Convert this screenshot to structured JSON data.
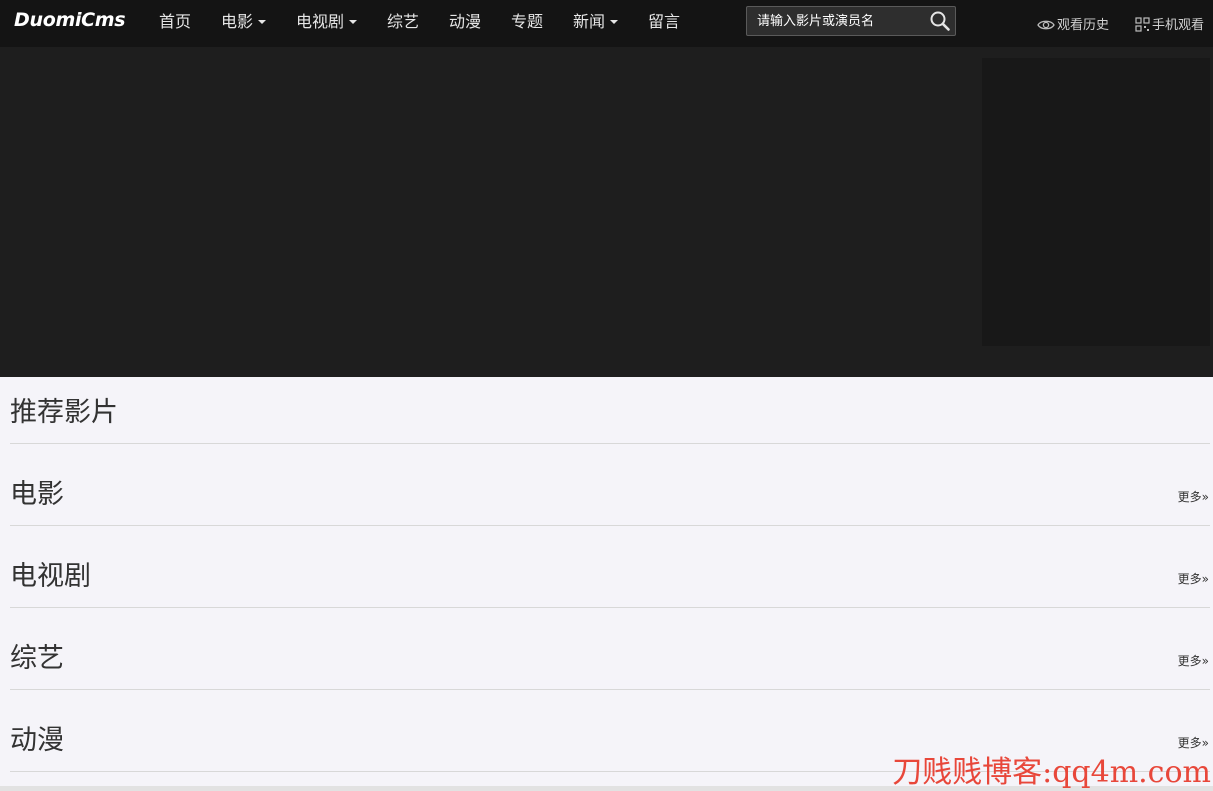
{
  "header": {
    "logo": "DuomiCms",
    "nav": [
      {
        "label": "首页",
        "has_dropdown": false
      },
      {
        "label": "电影",
        "has_dropdown": true
      },
      {
        "label": "电视剧",
        "has_dropdown": true
      },
      {
        "label": "综艺",
        "has_dropdown": false
      },
      {
        "label": "动漫",
        "has_dropdown": false
      },
      {
        "label": "专题",
        "has_dropdown": false
      },
      {
        "label": "新闻",
        "has_dropdown": true
      },
      {
        "label": "留言",
        "has_dropdown": false
      }
    ],
    "search": {
      "placeholder": "请输入影片或演员名",
      "icon": "search-icon"
    },
    "history": {
      "label": "观看历史",
      "icon": "eye-icon"
    },
    "mobile": {
      "label": "手机观看",
      "icon": "qrcode-icon"
    }
  },
  "sections": [
    {
      "title": "推荐影片",
      "more": ""
    },
    {
      "title": "电影",
      "more": "更多»"
    },
    {
      "title": "电视剧",
      "more": "更多»"
    },
    {
      "title": "综艺",
      "more": "更多»"
    },
    {
      "title": "动漫",
      "more": "更多»"
    }
  ],
  "watermark": "刀贱贱博客:qq4m.com",
  "colors": {
    "navbar_bg": "#141414",
    "banner_bg": "#1e1e1e",
    "page_bg": "#f5f4f9",
    "watermark": "#e8473a"
  }
}
